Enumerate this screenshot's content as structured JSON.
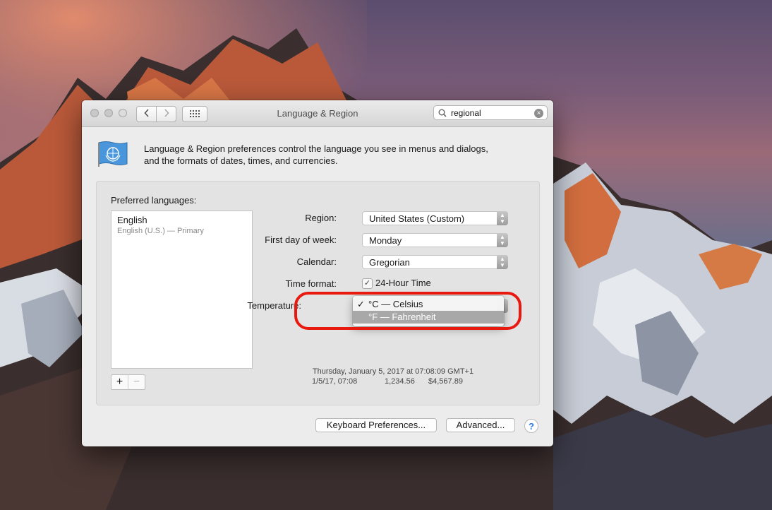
{
  "window": {
    "title": "Language & Region",
    "search_value": "regional",
    "description_line1": "Language & Region preferences control the language you see in menus and dialogs,",
    "description_line2": "and the formats of dates, times, and currencies."
  },
  "icons": {
    "back": "chevron-left-icon",
    "forward": "chevron-right-icon",
    "grid": "grid-icon",
    "search": "search-icon",
    "clear": "clear-icon",
    "flag": "un-flag-icon"
  },
  "languages": {
    "label": "Preferred languages:",
    "items": [
      {
        "name": "English",
        "detail": "English (U.S.) — Primary"
      }
    ],
    "add_label": "+",
    "remove_label": "−"
  },
  "settings": {
    "region_label": "Region:",
    "region_value": "United States (Custom)",
    "first_day_label": "First day of week:",
    "first_day_value": "Monday",
    "calendar_label": "Calendar:",
    "calendar_value": "Gregorian",
    "time_format_label": "Time format:",
    "time_format_option": "24-Hour Time",
    "time_format_checked": true,
    "temperature_label": "Temperature:"
  },
  "temperature_menu": {
    "items": [
      {
        "label": "°C — Celsius",
        "checked": true,
        "highlighted": false
      },
      {
        "label": "°F — Fahrenheit",
        "checked": false,
        "highlighted": true
      }
    ],
    "checkmark": "✓"
  },
  "sample": {
    "line1": "Thursday, January 5, 2017 at 07:08:09 GMT+1",
    "date_short": "1/5/17, 07:08",
    "number": "1,234.56",
    "currency": "$4,567.89"
  },
  "buttons": {
    "keyboard": "Keyboard Preferences...",
    "advanced": "Advanced...",
    "help": "?"
  },
  "colors": {
    "highlight_ring": "#e8190e",
    "help_blue": "#2a76e8"
  }
}
